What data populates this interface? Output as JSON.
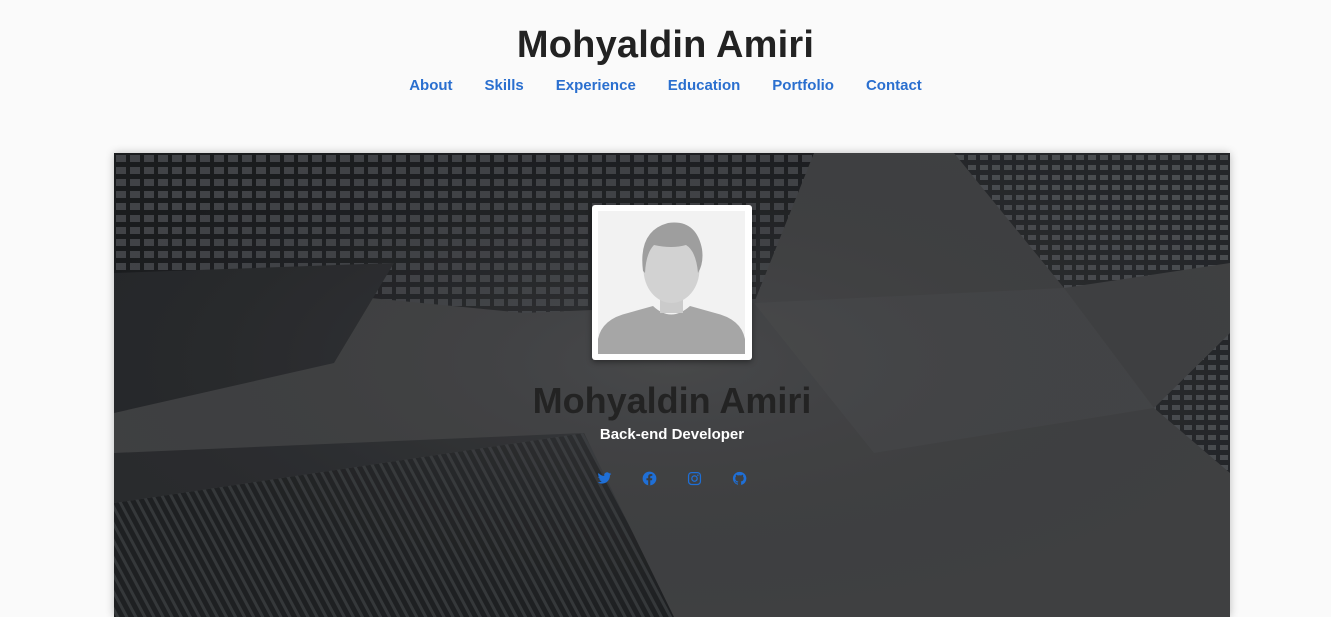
{
  "header": {
    "title": "Mohyaldin Amiri",
    "nav": [
      {
        "label": "About"
      },
      {
        "label": "Skills"
      },
      {
        "label": "Experience"
      },
      {
        "label": "Education"
      },
      {
        "label": "Portfolio"
      },
      {
        "label": "Contact"
      }
    ]
  },
  "hero": {
    "name": "Mohyaldin Amiri",
    "role": "Back-end Developer",
    "avatar_icon": "user-placeholder-icon",
    "socials": [
      {
        "icon": "twitter-icon"
      },
      {
        "icon": "facebook-icon"
      },
      {
        "icon": "instagram-icon"
      },
      {
        "icon": "github-icon"
      }
    ]
  },
  "colors": {
    "link": "#2a6fcf",
    "social": "#1f6fd6",
    "title": "#222222",
    "page_bg": "#fafafa"
  }
}
